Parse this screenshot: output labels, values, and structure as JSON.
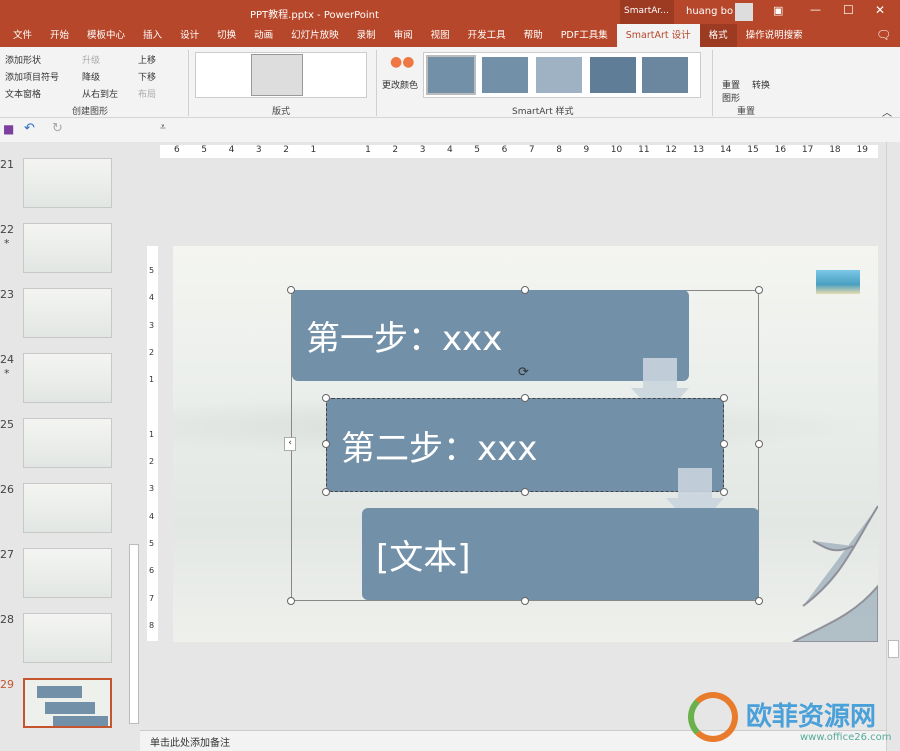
{
  "window": {
    "title": "PPT教程.pptx  -  PowerPoint",
    "context_tab": "SmartAr...",
    "user": "huang bo"
  },
  "tabs": [
    "文件",
    "开始",
    "模板中心",
    "插入",
    "设计",
    "切换",
    "动画",
    "幻灯片放映",
    "录制",
    "审阅",
    "视图",
    "开发工具",
    "帮助",
    "PDF工具集",
    "SmartArt 设计",
    "格式",
    "操作说明搜索"
  ],
  "ribbon": {
    "create": {
      "add_shape": "添加形状",
      "add_bullet": "添加项目符号",
      "text_pane": "文本窗格",
      "promote": "升级",
      "demote": "降级",
      "rtl": "从右到左",
      "move_up": "上移",
      "move_down": "下移",
      "layout": "布局",
      "label": "创建图形"
    },
    "layouts_label": "版式",
    "change_colors": "更改颜色",
    "styles_label": "SmartArt 样式",
    "reset": {
      "reset_graphic": "重置图形",
      "convert": "转换",
      "label": "重置"
    }
  },
  "thumbnails": [
    {
      "n": "21"
    },
    {
      "n": "22",
      "star": "*"
    },
    {
      "n": "23"
    },
    {
      "n": "24",
      "star": "*"
    },
    {
      "n": "25"
    },
    {
      "n": "26"
    },
    {
      "n": "27"
    },
    {
      "n": "28"
    },
    {
      "n": "29",
      "selected": true
    }
  ],
  "ruler": {
    "h": [
      "6",
      "5",
      "4",
      "3",
      "2",
      "1",
      "",
      "1",
      "2",
      "3",
      "4",
      "5",
      "6",
      "7",
      "8",
      "9",
      "10",
      "11",
      "12",
      "13",
      "14",
      "15",
      "16",
      "17",
      "18",
      "19"
    ],
    "v": [
      "5",
      "4",
      "3",
      "2",
      "1",
      "",
      "1",
      "2",
      "3",
      "4",
      "5",
      "6",
      "7",
      "8"
    ]
  },
  "smartart": {
    "items": [
      "第一步：xxx",
      "第二步：xxx",
      "[文本]"
    ],
    "fill": "#7290a8",
    "arrow": "#c9d4dd"
  },
  "notes": {
    "placeholder": "单击此处添加备注"
  },
  "watermark": {
    "name": "欧菲资源网",
    "url": "www.office26.com"
  }
}
